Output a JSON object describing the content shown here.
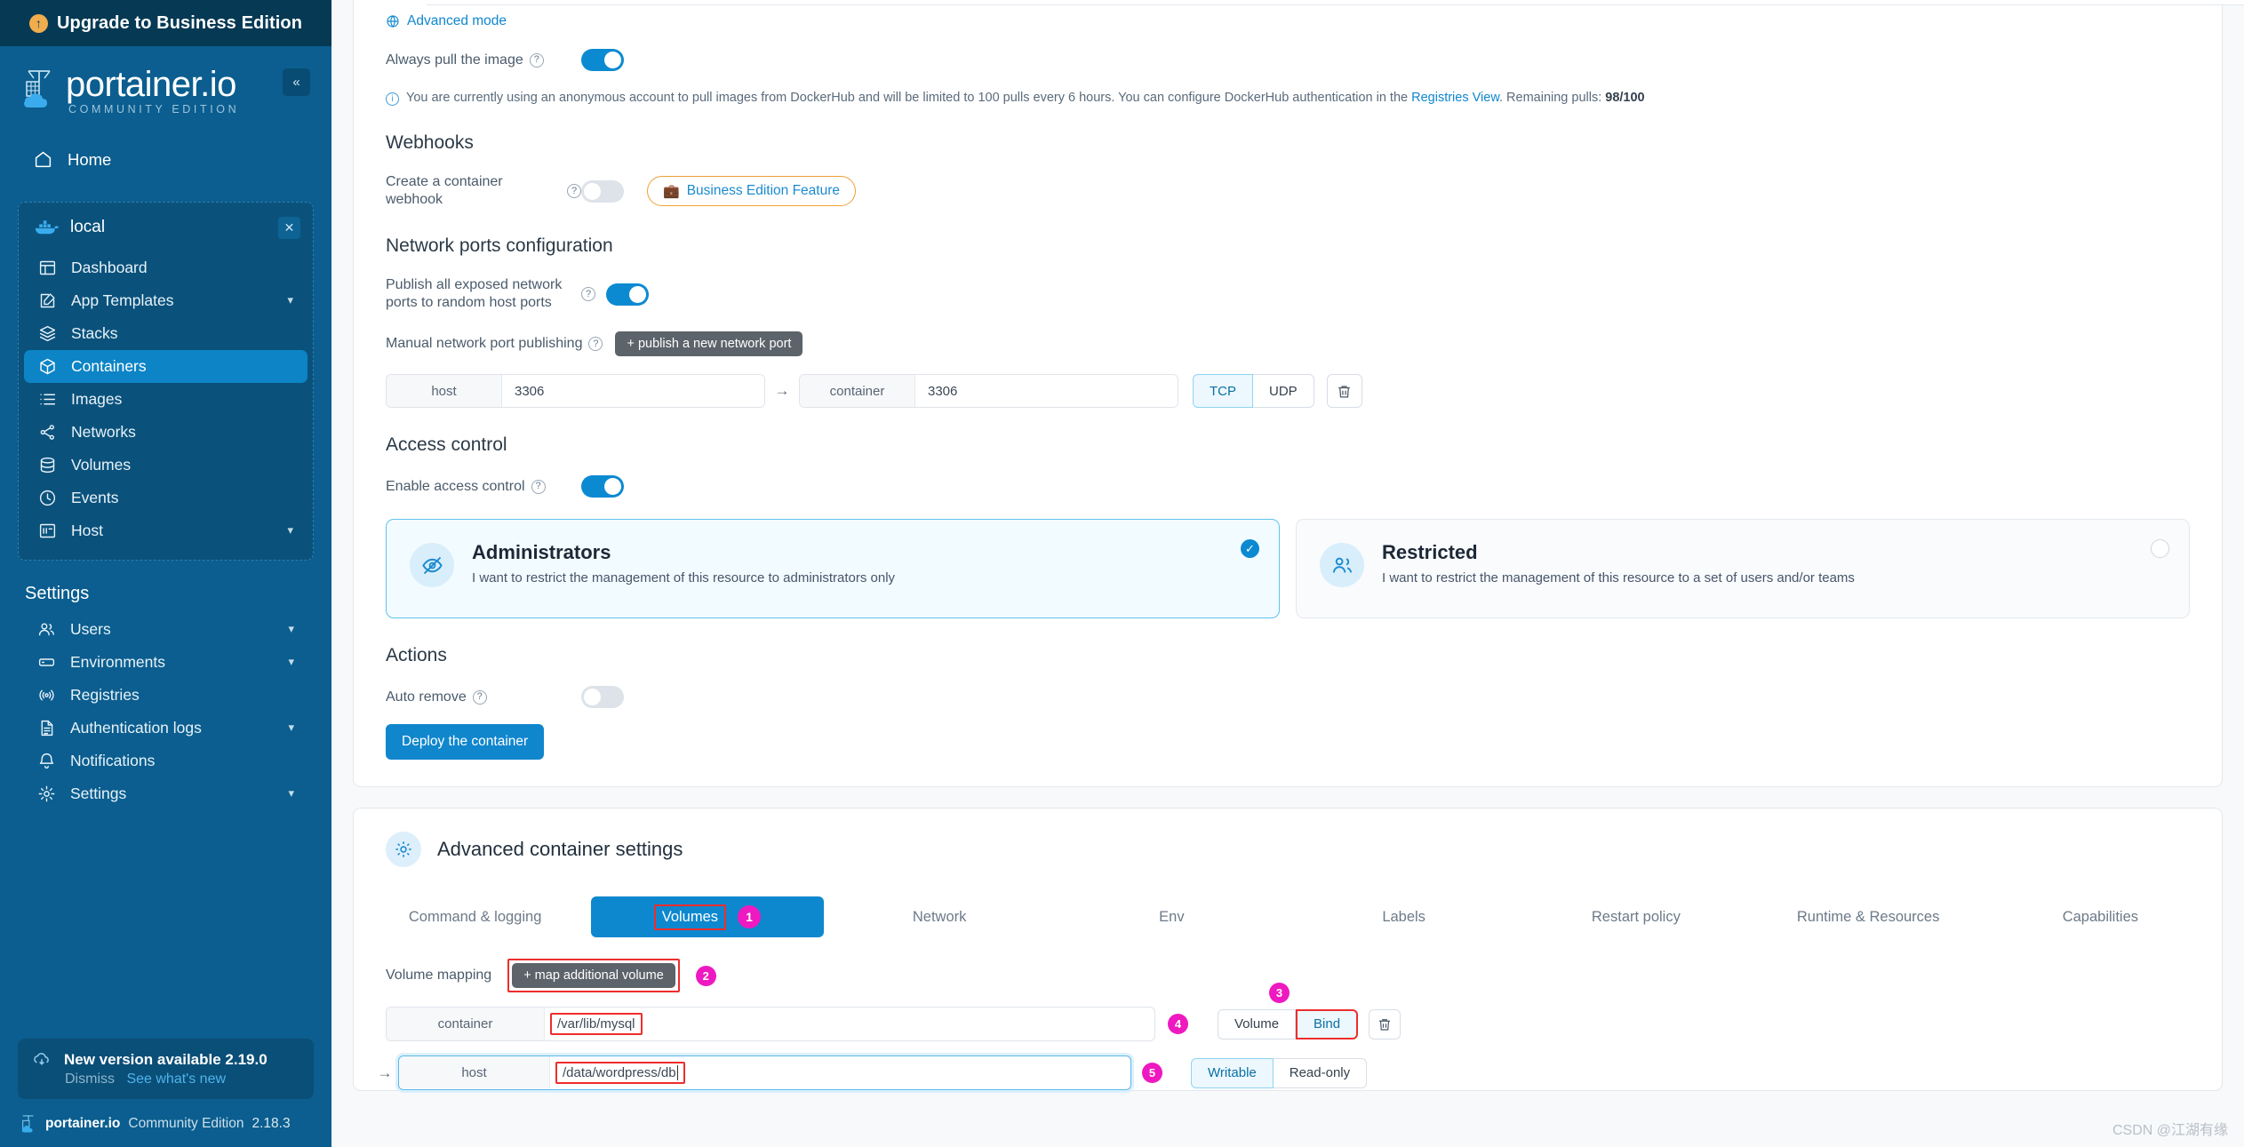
{
  "sidebar": {
    "upgrade_banner": "Upgrade to Business Edition",
    "brand_name": "portainer.io",
    "brand_sub": "COMMUNITY EDITION",
    "home_label": "Home",
    "environment_name": "local",
    "nav_items": [
      {
        "label": "Dashboard",
        "icon": "dashboard-icon",
        "chevron": "",
        "active": false
      },
      {
        "label": "App Templates",
        "icon": "templates-icon",
        "chevron": "⌄",
        "active": false
      },
      {
        "label": "Stacks",
        "icon": "stacks-icon",
        "chevron": "",
        "active": false
      },
      {
        "label": "Containers",
        "icon": "containers-icon",
        "chevron": "",
        "active": true
      },
      {
        "label": "Images",
        "icon": "images-icon",
        "chevron": "",
        "active": false
      },
      {
        "label": "Networks",
        "icon": "networks-icon",
        "chevron": "",
        "active": false
      },
      {
        "label": "Volumes",
        "icon": "volumes-icon",
        "chevron": "",
        "active": false
      },
      {
        "label": "Events",
        "icon": "events-icon",
        "chevron": "",
        "active": false
      },
      {
        "label": "Host",
        "icon": "host-icon",
        "chevron": "⌄",
        "active": false
      }
    ],
    "settings_title": "Settings",
    "settings_items": [
      {
        "label": "Users",
        "icon": "users-icon",
        "chevron": "⌄"
      },
      {
        "label": "Environments",
        "icon": "environments-icon",
        "chevron": "⌄"
      },
      {
        "label": "Registries",
        "icon": "registries-icon",
        "chevron": ""
      },
      {
        "label": "Authentication logs",
        "icon": "auth-logs-icon",
        "chevron": "⌄"
      },
      {
        "label": "Notifications",
        "icon": "bell-icon",
        "chevron": ""
      },
      {
        "label": "Settings",
        "icon": "gear-icon",
        "chevron": "⌄"
      }
    ],
    "version_notice": "New version available 2.19.0",
    "dismiss_label": "Dismiss",
    "whats_new_label": "See what's new",
    "footer_brand": "portainer.io",
    "footer_edition": "Community Edition",
    "footer_version": "2.18.3"
  },
  "main": {
    "advanced_mode_link": "Advanced mode",
    "always_pull_label": "Always pull the image",
    "notice_prefix": "You are currently using an anonymous account to pull images from DockerHub and will be limited to 100 pulls every 6 hours. You can configure DockerHub authentication in the ",
    "notice_link": "Registries View",
    "notice_mid": ". Remaining pulls: ",
    "notice_pulls": "98/100",
    "webhooks_title": "Webhooks",
    "webhook_label": "Create a container webhook",
    "business_badge": "Business Edition Feature",
    "network_title": "Network ports configuration",
    "publish_all_label": "Publish all exposed network ports to random host ports",
    "manual_publish_label": "Manual network port publishing",
    "publish_btn": "+ publish a new network port",
    "port_host_addon": "host",
    "port_host_value": "3306",
    "port_arrow": "→",
    "port_container_addon": "container",
    "port_container_value": "3306",
    "proto_tcp": "TCP",
    "proto_udp": "UDP",
    "delete_icon": "trash-icon",
    "access_title": "Access control",
    "enable_access_label": "Enable access control",
    "access_options": [
      {
        "title": "Administrators",
        "desc": "I want to restrict the management of this resource to administrators only",
        "icon": "eye-off-icon",
        "selected": true
      },
      {
        "title": "Restricted",
        "desc": "I want to restrict the management of this resource to a set of users and/or teams",
        "icon": "users-group-icon",
        "selected": false
      }
    ],
    "actions_title": "Actions",
    "auto_remove_label": "Auto remove",
    "deploy_btn": "Deploy the container",
    "adv_settings_title": "Advanced container settings",
    "tabs": [
      {
        "label": "Command & logging",
        "active": false,
        "badge": ""
      },
      {
        "label": "Volumes",
        "active": true,
        "badge": "1"
      },
      {
        "label": "Network",
        "active": false,
        "badge": ""
      },
      {
        "label": "Env",
        "active": false,
        "badge": ""
      },
      {
        "label": "Labels",
        "active": false,
        "badge": ""
      },
      {
        "label": "Restart policy",
        "active": false,
        "badge": ""
      },
      {
        "label": "Runtime & Resources",
        "active": false,
        "badge": ""
      },
      {
        "label": "Capabilities",
        "active": false,
        "badge": ""
      }
    ],
    "volume_mapping_label": "Volume mapping",
    "map_volume_btn": "+ map additional volume",
    "map_volume_badge": "2",
    "vol_container_addon": "container",
    "vol_container_value": "/var/lib/mysql",
    "vol_container_badge": "4",
    "vol_type_volume": "Volume",
    "vol_type_bind": "Bind",
    "vol_type_badge": "3",
    "vol_host_arrow": "→",
    "vol_host_addon": "host",
    "vol_host_value": "/data/wordpress/db",
    "vol_host_badge": "5",
    "vol_writable": "Writable",
    "vol_readonly": "Read-only"
  },
  "watermark": "CSDN @江湖有缘",
  "colors": {
    "sidebar_bg": "#0b5e8f",
    "banner_bg": "#063953",
    "accent_blue": "#0c8ad1",
    "highlight_red": "#ee2d2d",
    "badge_magenta": "#ee19c0",
    "orange": "#f0a034"
  }
}
